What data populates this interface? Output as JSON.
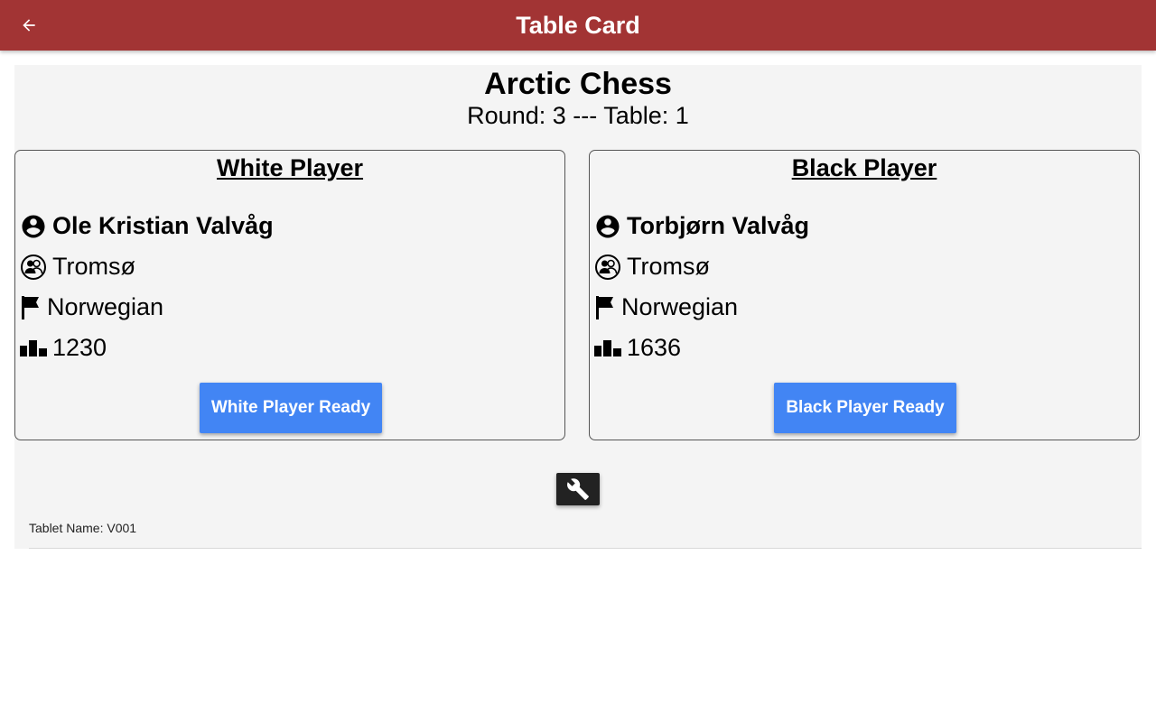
{
  "appbar": {
    "title": "Table Card",
    "back_icon": "arrow-back-icon",
    "color": "#a23434"
  },
  "event": {
    "name": "Arctic Chess",
    "round_line": "Round: 3 --- Table: 1"
  },
  "white": {
    "heading": "White Player",
    "name": "Ole Kristian Valvåg",
    "club": "Tromsø",
    "nationality": "Norwegian",
    "rating": "1230",
    "ready_label": "White Player Ready"
  },
  "black": {
    "heading": "Black Player",
    "name": "Torbjørn Valvåg",
    "club": "Tromsø",
    "nationality": "Norwegian",
    "rating": "1636",
    "ready_label": "Black Player Ready"
  },
  "icons": {
    "person": "account-circle-icon",
    "club": "group-icon",
    "nationality": "flag-icon",
    "rating": "podium-icon",
    "settings": "wrench-icon"
  },
  "footer": {
    "tablet_name": "Tablet Name: V001"
  },
  "colors": {
    "button": "#4285f4",
    "tool_button": "#222222",
    "panel": "#f4f4f4"
  }
}
